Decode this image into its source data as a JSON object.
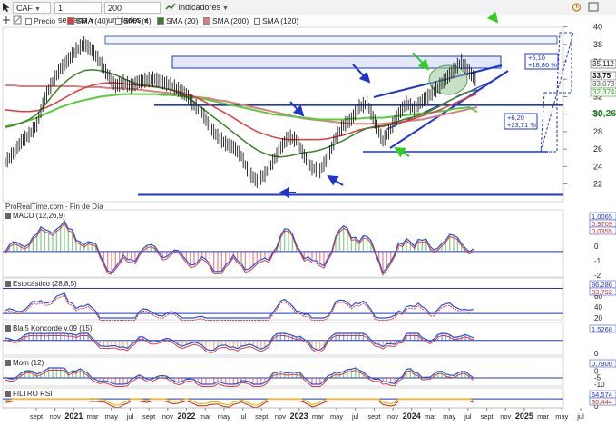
{
  "toolbar": {
    "symbol": "CAF",
    "timeframe": "1 semana",
    "units": "200 unidades",
    "indicators": "Indicadores"
  },
  "legend": {
    "precio": "Precio",
    "sma40": "SMA (40)",
    "sma4": "SMA (4)",
    "sma20": "SMA (20)",
    "sma200": "SMA (200)",
    "sma120": "SMA (120)"
  },
  "colors": {
    "price": "#1a1a1a",
    "sma40": "#e03a3a",
    "sma20": "#3a7f2a",
    "sma200": "#d98080",
    "sma120": "#58cc3c",
    "trendline": "#1f37c8",
    "accent_green": "#30d020"
  },
  "main": {
    "source_label": "ProRealTime.com - Fin de Día",
    "y_ticks": [
      40,
      38,
      36,
      34,
      32,
      30,
      28,
      26,
      24,
      22
    ],
    "value_tags": [
      {
        "text": "35,112",
        "color": "#ffffff",
        "text_color": "#111111"
      },
      {
        "text": "33,75",
        "color": "#ffffff",
        "text_color": "#111111"
      },
      {
        "text": "33,073",
        "color": "#ffffff",
        "text_color": "#555555"
      },
      {
        "text": "32,374",
        "color": "#ffffff",
        "text_color": "#3a9f2a"
      },
      {
        "text": "30,26",
        "color": "#ffffff",
        "text_color": "#1a8c1a"
      }
    ],
    "annotations": [
      {
        "line1": "+6,10",
        "line2": "+18,86 %"
      },
      {
        "line1": "+6,20",
        "line2": "+23,71 %"
      }
    ]
  },
  "panels": {
    "macd": {
      "label": "MACD (12,26,9)",
      "tags": [
        "1,0065",
        "0,9709",
        "0,0355"
      ],
      "ticks": [
        "2",
        "1",
        "0",
        "-1",
        "-2"
      ]
    },
    "stoch": {
      "label": "Estocástico (28,8,5)",
      "tags": [
        "86,286",
        "83,792"
      ],
      "ticks": [
        "80",
        "60",
        "40",
        "20"
      ]
    },
    "blai": {
      "label": "Blai5 Koncorde v.09 (15)",
      "tags": [
        "1,5268"
      ],
      "ticks": [
        "20",
        "0"
      ]
    },
    "mom": {
      "label": "Mom (12)",
      "tags": [
        "0,7900"
      ],
      "ticks": [
        "5",
        "0",
        "-5",
        "-10"
      ]
    },
    "rsi": {
      "label": "FILTRO RSI",
      "tags": [
        "64,574",
        "30,444"
      ],
      "ticks": [
        "50",
        "0"
      ]
    }
  },
  "x_axis": {
    "labels": [
      "sept",
      "nov",
      "2021",
      "mar",
      "may",
      "jul",
      "sept",
      "nov",
      "2022",
      "mar",
      "may",
      "jul",
      "sept",
      "nov",
      "2023",
      "mar",
      "may",
      "jul",
      "sept",
      "nov",
      "2024",
      "mar",
      "may",
      "jul",
      "sept",
      "nov",
      "2025",
      "mar",
      "may",
      "jul"
    ],
    "bold": [
      "2021",
      "2022",
      "2023",
      "2024",
      "2025"
    ]
  },
  "chart_data": {
    "type": "line",
    "title": "CAF",
    "series": [
      {
        "name": "Precio",
        "values": [
          24.5,
          25.5,
          26.8,
          27.6,
          28.8,
          31.8,
          33.7,
          35.2,
          36.2,
          37.3,
          38.0,
          37.3,
          36.0,
          34.5,
          33.2,
          33.6,
          33.2,
          33.7,
          33.9,
          34.0,
          33.6,
          33.3,
          32.8,
          32.2,
          31.0,
          30.2,
          28.5,
          27.4,
          26.6,
          26.2,
          25.2,
          23.2,
          22.3,
          23.1,
          24.5,
          26.1,
          27.4,
          27.0,
          25.2,
          23.8,
          23.5,
          25.0,
          27.3,
          28.7,
          29.4,
          30.8,
          31.2,
          29.1,
          26.9,
          28.3,
          30.0,
          31.2,
          30.6,
          31.5,
          32.2,
          33.0,
          34.0,
          35.0,
          36.0,
          34.8,
          33.75
        ]
      },
      {
        "name": "SMA (20)",
        "values": [
          28.5,
          28.7,
          29.0,
          29.4,
          30.0,
          31.0,
          32.2,
          33.2,
          34.0,
          34.6,
          35.0,
          35.1,
          35.0,
          34.8,
          34.5,
          34.1,
          33.7,
          33.4,
          33.3,
          33.2,
          33.0,
          32.8,
          32.5,
          32.0,
          31.4,
          30.7,
          30.0,
          29.3,
          28.6,
          27.9,
          27.2,
          26.5,
          25.9,
          25.5,
          25.2,
          25.1,
          25.2,
          25.4,
          25.6,
          25.7,
          25.9,
          26.2,
          26.6,
          27.0,
          27.5,
          28.0,
          28.4,
          28.6,
          28.7,
          28.9,
          29.2,
          29.5,
          29.7,
          30.0,
          30.4,
          30.8,
          31.3,
          31.8,
          32.3,
          32.6,
          32.8
        ]
      },
      {
        "name": "SMA (40)",
        "values": [
          30.5,
          30.4,
          30.3,
          30.3,
          30.4,
          30.7,
          31.1,
          31.6,
          32.1,
          32.6,
          33.0,
          33.3,
          33.5,
          33.6,
          33.6,
          33.5,
          33.4,
          33.3,
          33.2,
          33.1,
          33.0,
          32.8,
          32.6,
          32.3,
          32.0,
          31.6,
          31.1,
          30.6,
          30.1,
          29.6,
          29.0,
          28.5,
          28.0,
          27.7,
          27.4,
          27.2,
          27.1,
          27.1,
          27.1,
          27.1,
          27.1,
          27.2,
          27.4,
          27.6,
          27.9,
          28.2,
          28.4,
          28.5,
          28.6,
          28.8,
          29.0,
          29.2,
          29.5,
          29.8,
          30.1,
          30.4,
          30.8,
          31.2,
          31.6,
          32.0,
          32.3
        ]
      },
      {
        "name": "SMA (120)",
        "values": [
          28.6,
          28.8,
          29.0,
          29.3,
          29.6,
          30.0,
          30.4,
          30.8,
          31.1,
          31.4,
          31.6,
          31.8,
          32.0,
          32.1,
          32.2,
          32.3,
          32.3,
          32.3,
          32.3,
          32.3,
          32.2,
          32.2,
          32.1,
          32.0,
          31.9,
          31.8,
          31.6,
          31.4,
          31.2,
          31.0,
          30.8,
          30.6,
          30.4,
          30.2,
          30.0,
          29.9,
          29.8,
          29.7,
          29.6,
          29.5,
          29.4,
          29.4,
          29.4,
          29.4,
          29.5,
          29.5,
          29.6,
          29.6,
          29.6,
          29.7,
          29.8,
          29.9,
          30.0,
          30.1,
          30.2,
          30.3,
          30.4,
          30.6,
          30.7,
          30.8,
          30.26
        ]
      },
      {
        "name": "SMA (200)",
        "values": [
          33.3,
          33.3,
          33.2,
          33.2,
          33.2,
          33.2,
          33.2,
          33.2,
          33.2,
          33.2,
          33.1,
          33.1,
          33.1,
          33.0,
          33.0,
          32.9,
          32.9,
          32.8,
          32.7,
          32.6,
          32.5,
          32.4,
          32.3,
          32.2,
          32.0,
          31.9,
          31.8,
          31.6,
          31.5,
          31.3,
          31.1,
          30.9,
          30.7,
          30.5,
          30.3,
          30.1,
          29.9,
          29.7,
          29.5,
          29.4,
          29.3,
          29.2,
          29.1,
          29.0,
          28.9,
          28.9,
          28.9,
          28.9,
          28.9,
          29.0,
          29.1,
          29.2,
          29.3,
          29.4,
          29.6,
          29.8,
          30.0,
          30.2,
          30.4,
          30.6,
          30.8
        ]
      }
    ],
    "ylim": [
      20.5,
      41
    ],
    "legend": "top-left",
    "grid": false
  }
}
